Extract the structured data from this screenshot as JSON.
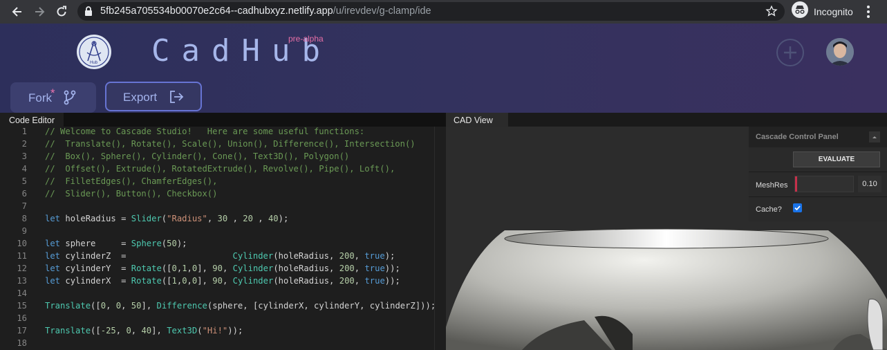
{
  "browser": {
    "url_host": "5fb245a705534b00070e2c64--cadhubxyz.netlify.app",
    "url_path": "/u/irevdev/g-clamp/ide",
    "incognito_label": "Incognito"
  },
  "header": {
    "brand": "CadHub",
    "badge": "pre-alpha",
    "logo_text": "Hub"
  },
  "toolbar": {
    "fork_label": "Fork",
    "fork_marker": "*",
    "export_label": "Export"
  },
  "editor": {
    "tab_label": "Code Editor",
    "lines": [
      {
        "n": "1",
        "text": "// Welcome to Cascade Studio!   Here are some useful functions:"
      },
      {
        "n": "2",
        "text": "//  Translate(), Rotate(), Scale(), Union(), Difference(), Intersection()"
      },
      {
        "n": "3",
        "text": "//  Box(), Sphere(), Cylinder(), Cone(), Text3D(), Polygon()"
      },
      {
        "n": "4",
        "text": "//  Offset(), Extrude(), RotatedExtrude(), Revolve(), Pipe(), Loft(),"
      },
      {
        "n": "5",
        "text": "//  FilletEdges(), ChamferEdges(),"
      },
      {
        "n": "6",
        "text": "//  Slider(), Button(), Checkbox()"
      },
      {
        "n": "7",
        "text": ""
      },
      {
        "n": "8",
        "text": "let holeRadius = Slider(\"Radius\", 30 , 20 , 40);"
      },
      {
        "n": "9",
        "text": ""
      },
      {
        "n": "10",
        "text": "let sphere     = Sphere(50);"
      },
      {
        "n": "11",
        "text": "let cylinderZ  =                     Cylinder(holeRadius, 200, true);"
      },
      {
        "n": "12",
        "text": "let cylinderY  = Rotate([0,1,0], 90, Cylinder(holeRadius, 200, true));"
      },
      {
        "n": "13",
        "text": "let cylinderX  = Rotate([1,0,0], 90, Cylinder(holeRadius, 200, true));"
      },
      {
        "n": "14",
        "text": ""
      },
      {
        "n": "15",
        "text": "Translate([0, 0, 50], Difference(sphere, [cylinderX, cylinderY, cylinderZ]));"
      },
      {
        "n": "16",
        "text": ""
      },
      {
        "n": "17",
        "text": "Translate([-25, 0, 40], Text3D(\"Hi!\"));"
      },
      {
        "n": "18",
        "text": ""
      }
    ]
  },
  "cad": {
    "tab_label": "CAD View",
    "panel_title": "Cascade Control Panel",
    "evaluate_label": "EVALUATE",
    "mesh_label": "MeshRes",
    "mesh_value": "0.10",
    "mesh_fraction": 0.02,
    "cache_label": "Cache?",
    "cache_checked": true
  },
  "colors": {
    "accent": "#6774d4",
    "pink": "#e76fa6",
    "checkbox": "#1a73e8"
  }
}
